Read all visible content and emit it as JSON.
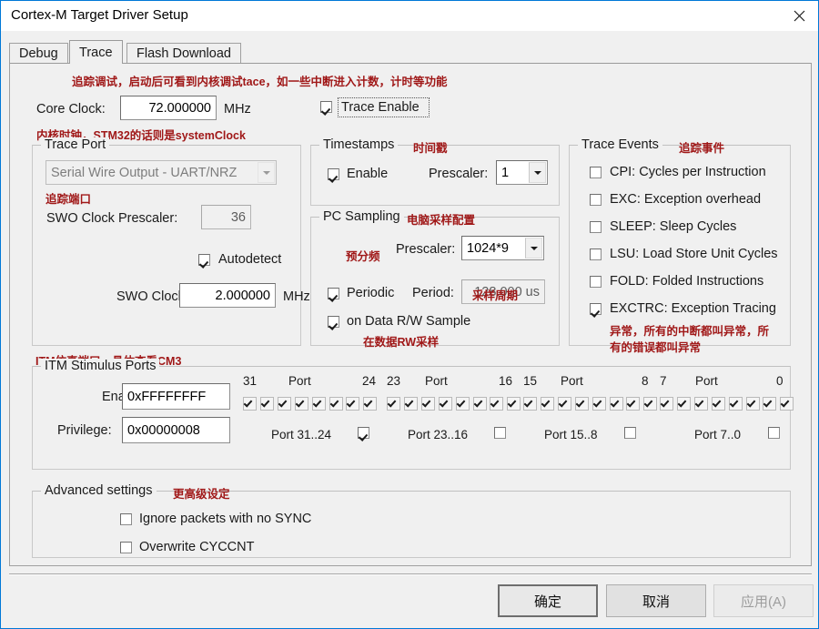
{
  "window": {
    "title": "Cortex-M Target Driver Setup",
    "close_icon": "close-icon"
  },
  "tabs": [
    {
      "label": "Debug",
      "active": false
    },
    {
      "label": "Trace",
      "active": true
    },
    {
      "label": "Flash Download",
      "active": false
    }
  ],
  "annotations": {
    "top": "追踪调试，启动后可看到内核调试tace，如一些中断进入计数，计时等功能",
    "core_clock": "内核时钟，STM32的话则是systemClock",
    "trace_port": "追踪端口",
    "itm_ports": "ITM仿真端口，具体查看CM3",
    "timestamps": "时间戳",
    "pc_sampling": "电脑采样配置",
    "prescaler": "预分频",
    "period": "采样周期",
    "data_rw": "在数据RW采样",
    "trace_events": "追踪事件",
    "exctrc_line1": "异常，所有的中断都叫异常，所",
    "exctrc_line2": "有的错误都叫异常",
    "advanced": "更高级设定"
  },
  "core": {
    "clock_label": "Core Clock:",
    "clock_value": "72.000000",
    "clock_unit": "MHz",
    "trace_enable_label": "Trace Enable",
    "trace_enable_checked": true
  },
  "trace_port": {
    "title": "Trace Port",
    "port_value": "Serial Wire Output - UART/NRZ",
    "port_disabled": true,
    "swo_prescaler_label": "SWO Clock Prescaler:",
    "swo_prescaler_value": "36",
    "autodetect_label": "Autodetect",
    "autodetect_checked": true,
    "swo_clock_label": "SWO Clock:",
    "swo_clock_value": "2.000000",
    "swo_clock_unit": "MHz"
  },
  "timestamps": {
    "title": "Timestamps",
    "enable_label": "Enable",
    "enable_checked": true,
    "prescaler_label": "Prescaler:",
    "prescaler_value": "1"
  },
  "pc_sampling": {
    "title": "PC Sampling",
    "prescaler_label": "Prescaler:",
    "prescaler_value": "1024*9",
    "periodic_label": "Periodic",
    "periodic_checked": true,
    "period_label": "Period:",
    "period_value": "128.000 us",
    "data_rw_label": "on Data R/W Sample",
    "data_rw_checked": true
  },
  "trace_events": {
    "title": "Trace Events",
    "items": [
      {
        "label": "CPI: Cycles per Instruction",
        "checked": false
      },
      {
        "label": "EXC: Exception overhead",
        "checked": false
      },
      {
        "label": "SLEEP: Sleep Cycles",
        "checked": false
      },
      {
        "label": "LSU: Load Store Unit Cycles",
        "checked": false
      },
      {
        "label": "FOLD: Folded Instructions",
        "checked": false
      },
      {
        "label": "EXCTRC: Exception Tracing",
        "checked": true
      }
    ]
  },
  "itm": {
    "title": "ITM Stimulus Ports",
    "enable_label": "Enable:",
    "enable_value": "0xFFFFFFFF",
    "privilege_label": "Privilege:",
    "privilege_value": "0x00000008",
    "port_headers": [
      {
        "high": "31",
        "mid": "Port",
        "low": "24"
      },
      {
        "high": "23",
        "mid": "Port",
        "low": "16"
      },
      {
        "high": "15",
        "mid": "Port",
        "low": "8"
      },
      {
        "high": "7",
        "mid": "Port",
        "low": "0"
      }
    ],
    "port_bits_checked": [
      true,
      true,
      true,
      true,
      true,
      true,
      true,
      true,
      true,
      true,
      true,
      true,
      true,
      true,
      true,
      true,
      true,
      true,
      true,
      true,
      true,
      true,
      true,
      true,
      true,
      true,
      true,
      true,
      true,
      true,
      true,
      true
    ],
    "groups": [
      {
        "label": "Port 31..24",
        "checked": true
      },
      {
        "label": "Port 23..16",
        "checked": false
      },
      {
        "label": "Port 15..8",
        "checked": false
      },
      {
        "label": "Port 7..0",
        "checked": false
      }
    ]
  },
  "advanced": {
    "title": "Advanced settings",
    "items": [
      {
        "label": "Ignore packets with no SYNC",
        "checked": false
      },
      {
        "label": "Overwrite CYCCNT",
        "checked": false
      }
    ]
  },
  "buttons": {
    "ok": "确定",
    "cancel": "取消",
    "apply": "应用(A)"
  }
}
